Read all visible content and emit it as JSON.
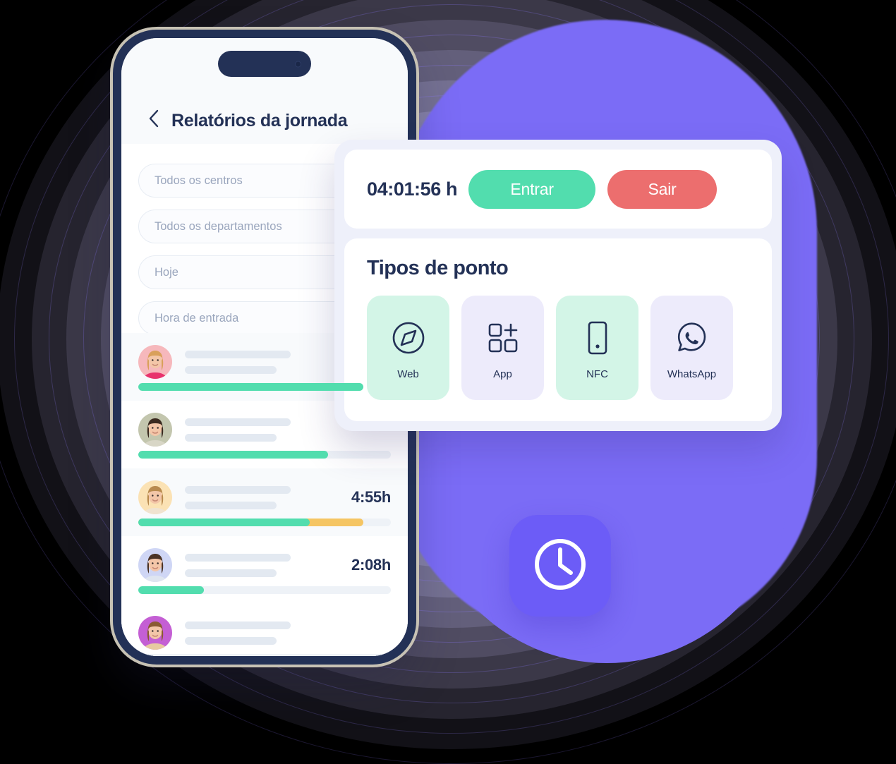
{
  "phone": {
    "header": {
      "back_icon": "chevron-left-icon",
      "title": "Relatórios da jornada"
    },
    "filters": [
      {
        "name": "centers",
        "value": "Todos os centros"
      },
      {
        "name": "departments",
        "value": "Todos os departamentos"
      },
      {
        "name": "date",
        "value": "Hoje"
      },
      {
        "name": "entry_time",
        "value": "Hora de entrada"
      }
    ],
    "filter_placeholders": {
      "centers": "Todos os centros",
      "departments": "Todos os departamentos",
      "date": "Hoje",
      "entry_time": "Hora de entrada"
    },
    "rows": [
      {
        "time": "",
        "green_pct": 89,
        "yellow_pct": 0,
        "avatar_bg": "#f6b8bc",
        "avatar_hair": "#d9a05b",
        "avatar_shirt": "#e8336d",
        "alt": true
      },
      {
        "time": "",
        "green_pct": 75,
        "yellow_pct": 0,
        "avatar_bg": "#c3c6ae",
        "avatar_hair": "#3b2a20",
        "avatar_shirt": "#d8d6c6",
        "alt": false
      },
      {
        "time": "4:55h",
        "green_pct": 68,
        "yellow_pct": 89,
        "avatar_bg": "#fbe2b4",
        "avatar_hair": "#b98a4e",
        "avatar_shirt": "#f0e3d0",
        "alt": true
      },
      {
        "time": "2:08h",
        "green_pct": 26,
        "yellow_pct": 0,
        "avatar_bg": "#cfd6f5",
        "avatar_hair": "#4a3326",
        "avatar_shirt": "#dfe5f0",
        "alt": false
      },
      {
        "time": "",
        "green_pct": 0,
        "yellow_pct": 0,
        "avatar_bg": "#c45fd4",
        "avatar_hair": "#8a5a33",
        "avatar_shirt": "#e7c9a0",
        "alt": false
      }
    ]
  },
  "card": {
    "timer": {
      "value": "04:01:56 h",
      "enter_label": "Entrar",
      "exit_label": "Sair"
    },
    "types": {
      "title": "Tipos de ponto",
      "tiles": [
        {
          "label": "Web",
          "icon": "compass-icon",
          "theme": "mint"
        },
        {
          "label": "App",
          "icon": "grid-plus-icon",
          "theme": "lav"
        },
        {
          "label": "NFC",
          "icon": "phone-nfc-icon",
          "theme": "mint"
        },
        {
          "label": "WhatsApp",
          "icon": "whatsapp-icon",
          "theme": "lav"
        }
      ]
    }
  },
  "clock_badge": {
    "icon": "clock-icon"
  },
  "colors": {
    "navy": "#233156",
    "green": "#52ddae",
    "red": "#ec6e6e",
    "yellow": "#f5c563",
    "purple": "#6c5cf7",
    "mint_tile": "#d3f5e7",
    "lavender_tile": "#edebfb",
    "card_bg": "#eef0fa"
  }
}
